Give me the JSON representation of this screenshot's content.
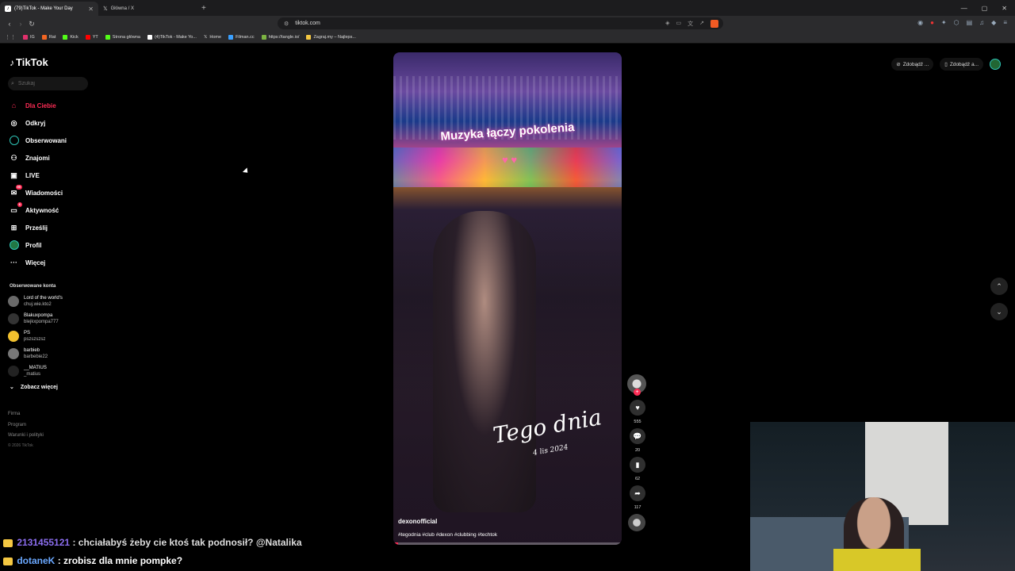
{
  "browser": {
    "tabs": [
      {
        "label": "(79)TikTok - Make Your Day",
        "active": true,
        "favicon": "tiktok-icon"
      },
      {
        "label": "Główna / X",
        "active": false,
        "favicon": "x-icon"
      }
    ],
    "url": "tiktok.com",
    "bookmarks": [
      {
        "label": "IG",
        "color": "#e1306c"
      },
      {
        "label": "Rat",
        "color": "#f26522"
      },
      {
        "label": "Kick",
        "color": "#53fc18"
      },
      {
        "label": "YT",
        "color": "#ff0000"
      },
      {
        "label": "Strona główna",
        "color": "#53fc18"
      },
      {
        "label": "(4)TikTok - Make Yo...",
        "color": "#ffffff"
      },
      {
        "label": "Home",
        "color": "#ffffff"
      },
      {
        "label": "Filman.cc",
        "color": "#3aa0ff"
      },
      {
        "label": "https://tangle.io/",
        "color": "#7cb342"
      },
      {
        "label": "Zagraj.my – Najleps...",
        "color": "#f5c842"
      }
    ]
  },
  "sidebar": {
    "logo": "TikTok",
    "search_placeholder": "Szukaj",
    "nav": [
      {
        "label": "Dla Ciebie",
        "icon": "home-icon",
        "active": true
      },
      {
        "label": "Odkryj",
        "icon": "compass-icon"
      },
      {
        "label": "Obserwowani",
        "icon": "following-icon"
      },
      {
        "label": "Znajomi",
        "icon": "friends-icon"
      },
      {
        "label": "LIVE",
        "icon": "live-icon"
      },
      {
        "label": "Wiadomości",
        "icon": "messages-icon",
        "badge": "99"
      },
      {
        "label": "Aktywność",
        "icon": "activity-icon",
        "badge": "6"
      },
      {
        "label": "Prześlij",
        "icon": "upload-icon"
      },
      {
        "label": "Profil",
        "icon": "profile-icon"
      },
      {
        "label": "Więcej",
        "icon": "more-icon"
      }
    ],
    "following_title": "Obserwowane konta",
    "following": [
      {
        "name": "Lord of the world's",
        "user": "chuj.wie.kto2"
      },
      {
        "name": "Blakuxpompa",
        "user": "blejkxpompa777"
      },
      {
        "name": "PS",
        "user": "pszszszsz"
      },
      {
        "name": "barbieb",
        "user": "barbebie22"
      },
      {
        "name": "__MATIUS",
        "user": "_matius"
      }
    ],
    "see_more": "Zobacz więcej",
    "footer": [
      "Firma",
      "Program",
      "Warunki i polityki"
    ],
    "copyright": "© 2026 TikTok"
  },
  "video": {
    "caption_top": "Muzyka łączy pokolenia",
    "caption_mid": "Tego dnia",
    "caption_date": "4 lis 2024",
    "author": "dexonofficial",
    "tags": "#tegodnia #club #dexon #clubbing #techtok",
    "progress": 0.02
  },
  "actions": {
    "likes": "555",
    "comments": "20",
    "saves": "62",
    "shares": "117"
  },
  "top_buttons": {
    "coins": "Zdobądź ...",
    "app": "Zdobądź a..."
  },
  "chat": {
    "line1_user": "2131455121",
    "line1_text": ": chciałabyś żeby cie ktoś tak podnosił? @Natalika",
    "line2_user": "dotaneK",
    "line2_text": ": zrobisz dla mnie pompke?"
  }
}
